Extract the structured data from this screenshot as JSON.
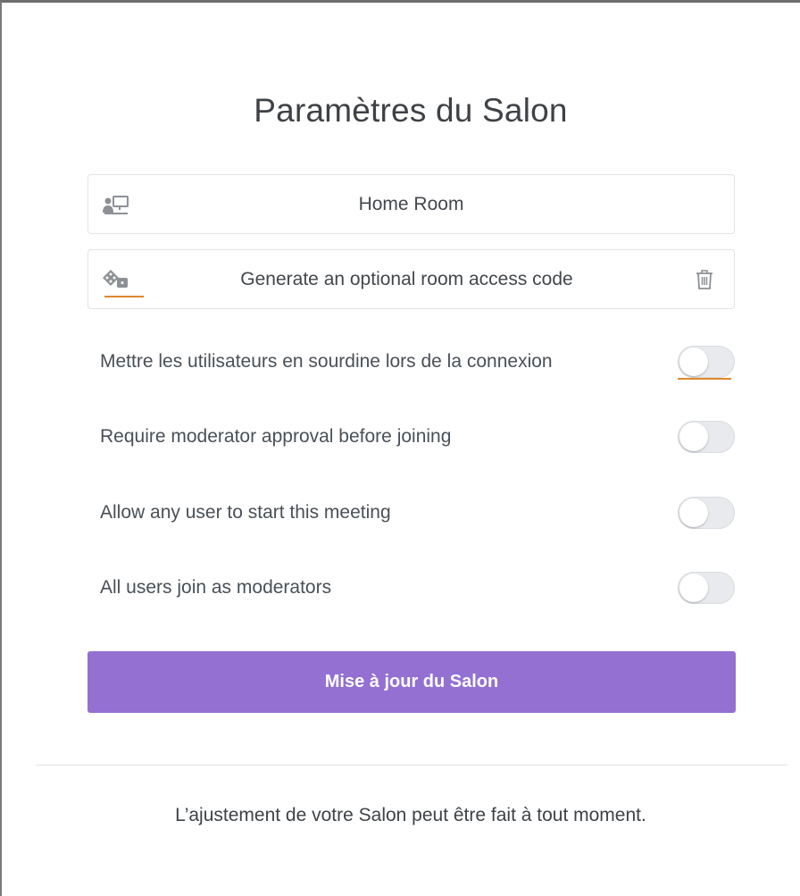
{
  "modal": {
    "title": "Paramètres du Salon"
  },
  "name_field": {
    "icon": "presentation-screen-icon",
    "value": "Home Room"
  },
  "access_code_field": {
    "icon": "dice-icon",
    "placeholder": "Generate an optional room access code",
    "delete_icon": "trash-icon"
  },
  "settings": [
    {
      "label": "Mettre les utilisateurs en sourdine lors de la connexion",
      "enabled": false
    },
    {
      "label": "Require moderator approval before joining",
      "enabled": false
    },
    {
      "label": "Allow any user to start this meeting",
      "enabled": false
    },
    {
      "label": "All users join as moderators",
      "enabled": false
    }
  ],
  "submit_button": {
    "label": "Mise à jour du Salon"
  },
  "footer": {
    "text": "L’ajustement de votre Salon peut être fait à tout moment."
  },
  "colors": {
    "accent": "#9370d2",
    "focus_underline": "#e0872e",
    "toggle_off": "#e8eaed"
  }
}
